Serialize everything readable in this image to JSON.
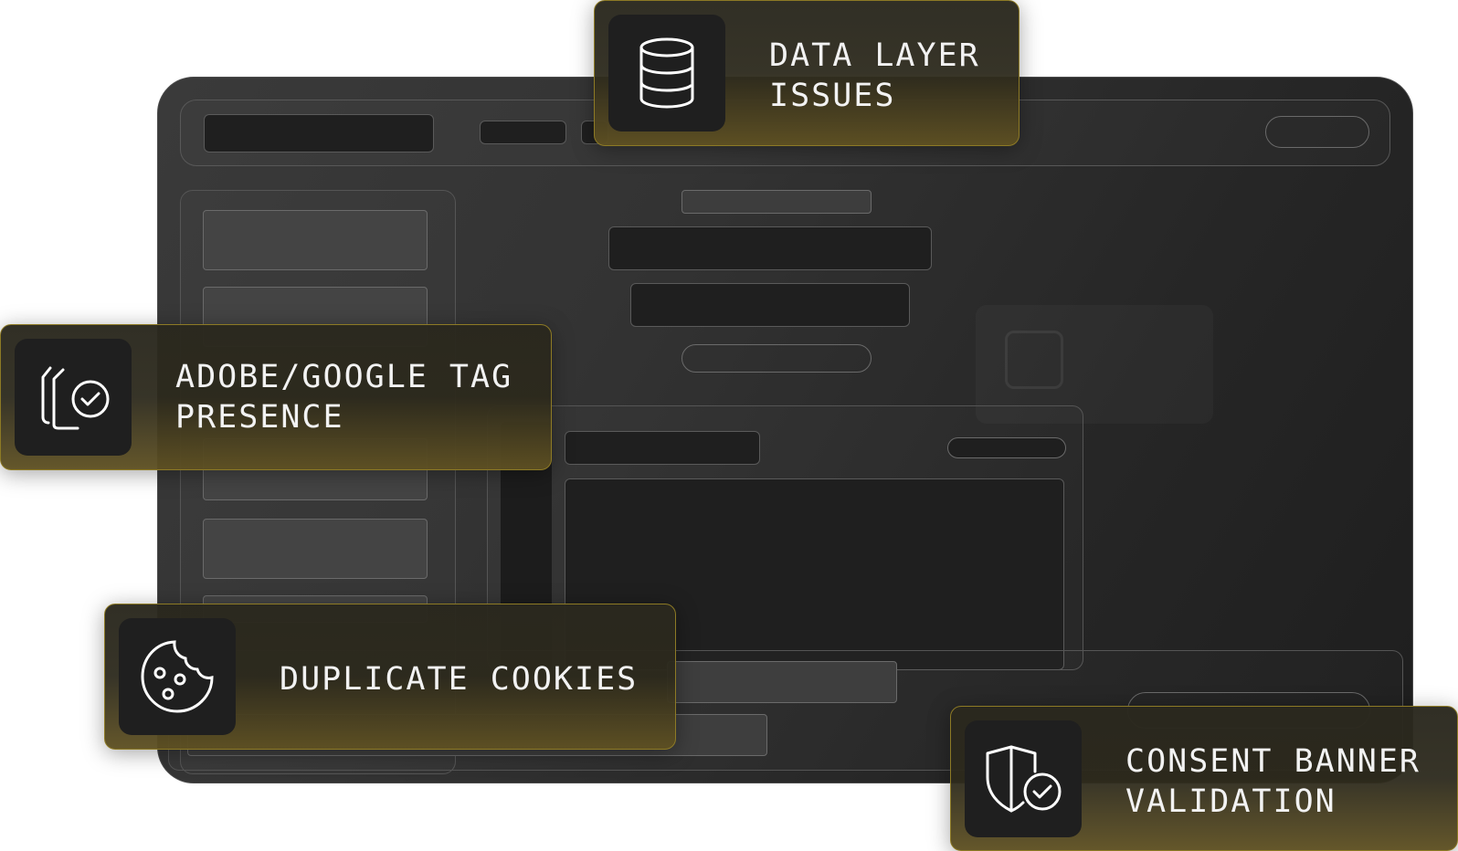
{
  "callouts": {
    "data_layer": {
      "label": "DATA LAYER\nISSUES",
      "icon": "database-icon"
    },
    "tag_presence": {
      "label": "ADOBE/GOOGLE TAG\nPRESENCE",
      "icon": "tags-check-icon"
    },
    "cookies": {
      "label": "DUPLICATE COOKIES",
      "icon": "cookie-icon"
    },
    "consent": {
      "label": "CONSENT BANNER\nVALIDATION",
      "icon": "shield-check-icon"
    }
  },
  "colors": {
    "card_border": "#8d7a25",
    "card_gold": "#5e5022",
    "icon_bg": "#1f1f1f",
    "window_bg": "#333333"
  }
}
